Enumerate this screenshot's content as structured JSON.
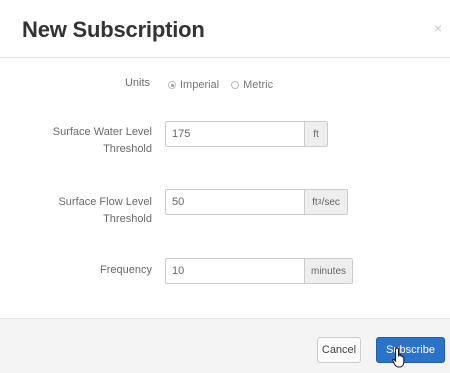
{
  "dialog": {
    "title": "New Subscription",
    "close_symbol": "×"
  },
  "form": {
    "units": {
      "label": "Units",
      "options": [
        {
          "label": "Imperial",
          "checked": true
        },
        {
          "label": "Metric",
          "checked": false
        }
      ]
    },
    "water_level": {
      "label_line1": "Surface Water Level",
      "label_line2": "Threshold",
      "value": "175",
      "unit": "ft"
    },
    "flow_level": {
      "label_line1": "Surface Flow Level",
      "label_line2": "Threshold",
      "value": "50",
      "unit_base": "ft",
      "unit_sup": "3",
      "unit_tail": "/sec"
    },
    "frequency": {
      "label": "Frequency",
      "value": "10",
      "unit": "minutes"
    }
  },
  "footer": {
    "cancel_label": "Cancel",
    "subscribe_label": "Subscribe"
  },
  "colors": {
    "primary": "#2b73c8"
  },
  "icons": {
    "cursor": "hand-pointer-icon",
    "close": "close-icon"
  }
}
